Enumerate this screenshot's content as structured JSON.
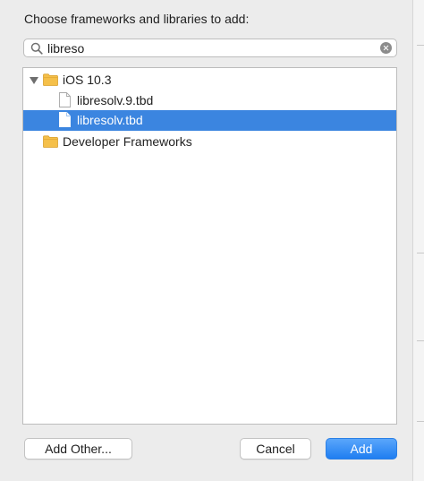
{
  "dialog": {
    "title": "Choose frameworks and libraries to add:"
  },
  "search": {
    "value": "libreso",
    "placeholder": ""
  },
  "tree": {
    "items": [
      {
        "label": "iOS 10.3",
        "kind": "folder",
        "expanded": true,
        "selected": false,
        "icon": "folder-icon"
      },
      {
        "label": "libresolv.9.tbd",
        "kind": "file",
        "selected": false,
        "icon": "document-icon"
      },
      {
        "label": "libresolv.tbd",
        "kind": "file",
        "selected": true,
        "icon": "document-icon"
      },
      {
        "label": "Developer Frameworks",
        "kind": "folder",
        "expanded": false,
        "selected": false,
        "icon": "folder-icon"
      }
    ]
  },
  "buttons": {
    "add_other": "Add Other...",
    "cancel": "Cancel",
    "add": "Add"
  },
  "colors": {
    "selection": "#3b85e0",
    "primary_button": "#1f7ef1",
    "folder": "#f5c04a"
  }
}
